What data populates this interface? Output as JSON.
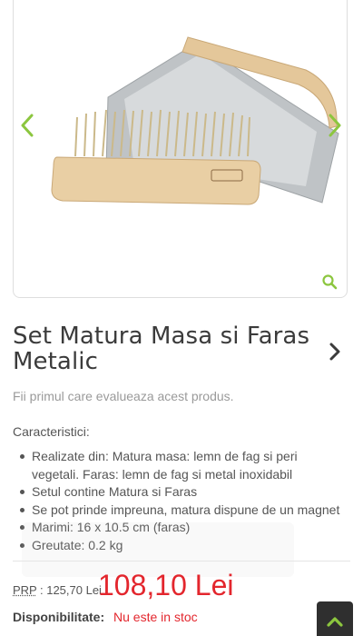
{
  "product": {
    "title": "Set Matura Masa si Faras Metalic",
    "rating_prompt": "Fii primul care evalueaza acest produs.",
    "specs_heading": "Caracteristici:",
    "specs": [
      "Realizate din: Matura masa: lemn de fag si peri vegetali. Faras: lemn de fag si metal inoxidabil",
      "Setul contine Matura si Faras",
      "Se pot prinde impreuna, matura dispune de un magnet",
      "Marimi: 16 x 10.5 cm (faras)",
      "Greutate: 0.2 kg"
    ],
    "prp_label": "PRP",
    "prp_value": ": 125,70 Lei",
    "price": "108,10 Lei",
    "availability_label": "Disponibilitate:",
    "availability_value": "Nu este in stoc"
  },
  "icons": {
    "gallery_prev": "chevron-left-icon",
    "gallery_next": "chevron-right-icon",
    "zoom": "magnifier-icon",
    "next_product": "chevron-right-icon",
    "scroll_top": "chevron-up-icon"
  },
  "colors": {
    "accent_green": "#8cc63f",
    "price_red": "#e3262d",
    "text_dark": "#3b3b3b",
    "button_dark": "#2f2f2f"
  }
}
